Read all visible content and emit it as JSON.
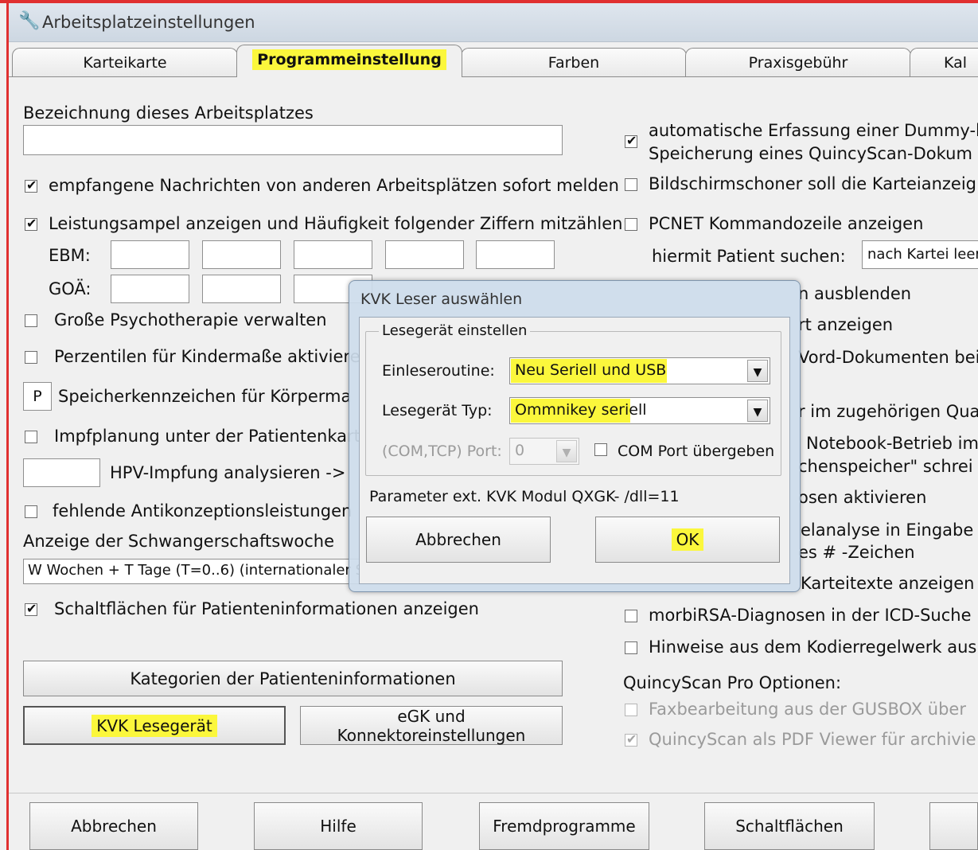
{
  "window": {
    "title": "Arbeitsplatzeinstellungen",
    "accent": "#fbf73c",
    "mark": "#e03030"
  },
  "tabs": [
    {
      "label": "Karteikarte"
    },
    {
      "label": "Programmeinstellung"
    },
    {
      "label": "Farben"
    },
    {
      "label": "Praxisgebühr"
    },
    {
      "label": "Kal"
    }
  ],
  "left": {
    "bezeichnung_label": "Bezeichnung dieses Arbeitsplatzes",
    "bezeichnung_value": "",
    "cb_nachrichten": "empfangene Nachrichten von anderen Arbeitsplätzen sofort melden",
    "cb_leistungsampel": "Leistungsampel anzeigen und Häufigkeit folgender Ziffern mitzählen:",
    "ebm_label": "EBM:",
    "goa_label": "GOÄ:",
    "cb_psychotherapie": "Große Psychotherapie verwalten",
    "cb_perzentilen": "Perzentilen für Kindermaße aktiviere",
    "speicher_value": "P",
    "speicher_label": "Speicherkennzeichen für Körperma",
    "cb_impfplanung": "Impfplanung unter der Patientenkart",
    "hpv_label": "HPV-Impfung analysieren ->",
    "cb_antikonzeption": "fehlende Antikonzeptionsleistungen",
    "schwanger_label": "Anzeige der Schwangerschaftswoche",
    "schwanger_value": "W Wochen + T Tage (T=0..6) (internationaler St",
    "cb_schaltflaechen": "Schaltflächen für Patienteninformationen anzeigen",
    "btn_kategorien": "Kategorien der Patienteninformationen",
    "btn_kvk": "KVK Lesegerät",
    "btn_egk": "eGK und Konnektoreinstellungen"
  },
  "right": {
    "cb_dummy_l1": "automatische Erfassung einer Dummy-l",
    "cb_dummy_l2": "Speicherung eines QuincyScan-Dokum",
    "cb_bildschirm": "Bildschirmschoner soll die Karteianzeig",
    "cb_pcnet": "PCNET Kommandozeile anzeigen",
    "suchen_label": "hiermit Patient suchen:",
    "suchen_value": "nach Kartei leer",
    "frag_ausblenden": "n ausblenden",
    "frag_anzeigen": "rt anzeigen",
    "frag_word": "Vord-Dokumenten bei",
    "frag_zugehoerig": "r im zugehörigen Qua",
    "frag_notebook": "Notebook-Betrieb im",
    "frag_speicher": "chenspeicher\" schrei",
    "frag_aktivieren": "osen aktivieren",
    "frag_analyse": "elanalyse in Eingabe",
    "frag_zeichen": "es # -Zeichen",
    "frag_karteitexte": "Karteitexte anzeigen",
    "cb_morbi": "morbiRSA-Diagnosen in der ICD-Suche",
    "cb_hinweise": "Hinweise aus dem Kodierregelwerk aus",
    "quincy_title": "QuincyScan Pro Optionen:",
    "cb_fax": "Faxbearbeitung aus der GUSBOX über",
    "cb_pdf": "QuincyScan als PDF Viewer für archivie"
  },
  "bottom": {
    "abbrechen": "Abbrechen",
    "hilfe": "Hilfe",
    "fremd": "Fremdprogramme",
    "schalt": "Schaltflächen"
  },
  "dialog": {
    "title": "KVK Leser auswählen",
    "group": "Lesegerät einstellen",
    "einlese_label": "Einleseroutine:",
    "einlese_value": "Neu Seriell und USB",
    "typ_label": "Lesegerät Typ:",
    "typ_value": "Ommnikey seriell",
    "port_label": "(COM,TCP) Port:",
    "port_value": "0",
    "com_label": "COM Port übergeben",
    "param": "Parameter ext. KVK Modul QXGK- /dll=11",
    "abbrechen": "Abbrechen",
    "ok": "OK"
  }
}
